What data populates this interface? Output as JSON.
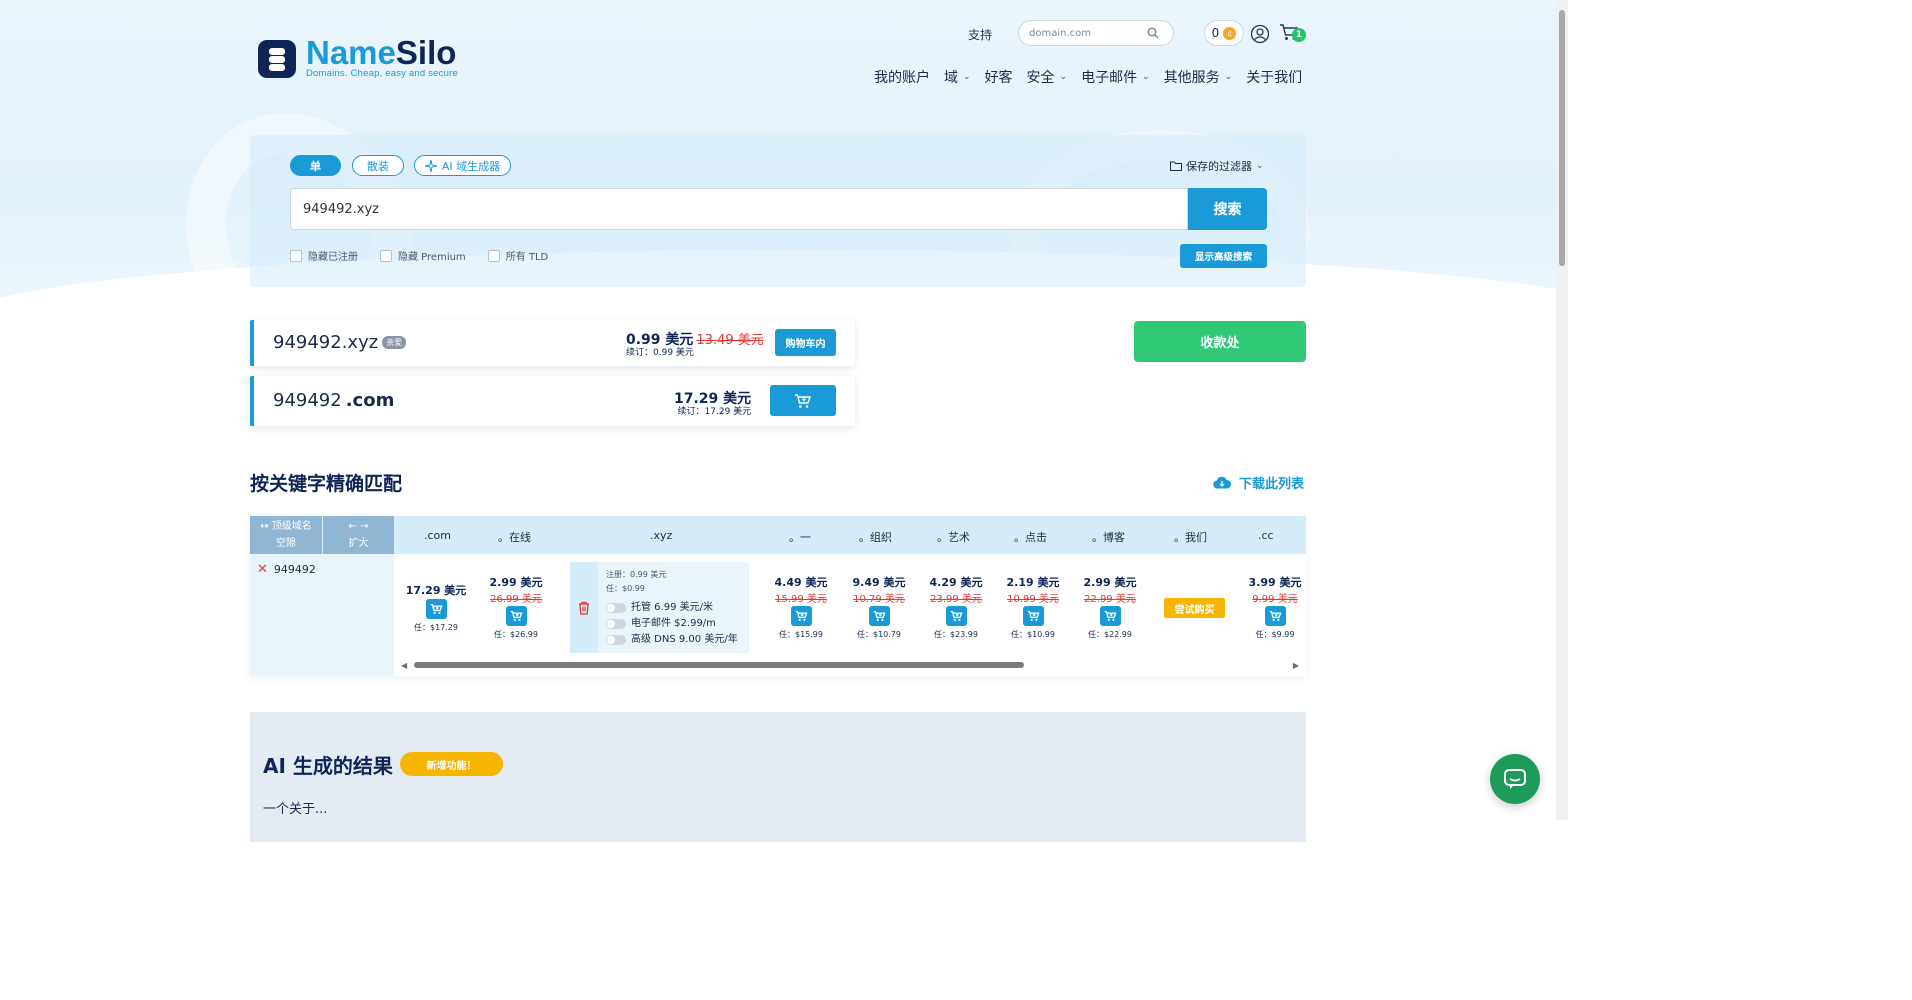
{
  "brand": {
    "name_part1": "Name",
    "name_part2": "Silo",
    "tagline": "Domains. Cheap, easy and secure"
  },
  "header": {
    "support": "支持",
    "search_placeholder": "domain.com",
    "coin_count": "0",
    "coin_symbol": "¢",
    "cart_count": "1",
    "nav": [
      {
        "label": "我的账户",
        "has_dropdown": false
      },
      {
        "label": "域",
        "has_dropdown": true
      },
      {
        "label": "好客",
        "has_dropdown": false
      },
      {
        "label": "安全",
        "has_dropdown": true
      },
      {
        "label": "电子邮件",
        "has_dropdown": true
      },
      {
        "label": "其他服务",
        "has_dropdown": true
      },
      {
        "label": "关于我们",
        "has_dropdown": false
      }
    ]
  },
  "search": {
    "modes": {
      "single": "单",
      "bulk": "散装",
      "ai": "AI 域生成器"
    },
    "saved_filters": "保存的过滤器",
    "query": "949492.xyz",
    "button": "搜索",
    "filters": {
      "hide_registered": "隐藏已注册",
      "hide_premium": "隐藏 Premium",
      "all_tld": "所有 TLD"
    },
    "advanced": "显示高级搜索"
  },
  "results": [
    {
      "name": "949492.xyz",
      "sld": "949492",
      "tld": ".xyz",
      "badge": "亲爱",
      "price": "0.99 美元",
      "old_price": "13.49 美元",
      "renew": "续订：0.99 美元",
      "action": "购物车内"
    },
    {
      "name": "949492.com",
      "sld": "949492",
      "tld": ".com",
      "price": "17.29 美元",
      "renew": "续订：17.29 美元"
    }
  ],
  "checkout": "收款处",
  "exact_match": {
    "title": "按关键字精确匹配",
    "download": "下载此列表",
    "left_header": {
      "col1_line1": "↔ 顶级域名",
      "col1_line2": "空隙",
      "col2_line1": "← →",
      "col2_line2": "扩大"
    },
    "keyword": "949492",
    "columns": [
      {
        "tld": ".com",
        "price": "17.29 美元",
        "renew": "任：$17.29"
      },
      {
        "tld": "。在线",
        "price": "2.99 美元",
        "old": "26.99 美元",
        "renew": "任：$26.99"
      },
      {
        "tld": ".xyz"
      },
      {
        "tld": "。一",
        "price": "4.49 美元",
        "old": "15.99 美元",
        "renew": "任：$15.99"
      },
      {
        "tld": "。组织",
        "price": "9.49 美元",
        "old": "10.79 美元",
        "renew": "任：$10.79"
      },
      {
        "tld": "。艺术",
        "price": "4.29 美元",
        "old": "23.99 美元",
        "renew": "任：$23.99"
      },
      {
        "tld": "。点击",
        "price": "2.19 美元",
        "old": "10.99 美元",
        "renew": "任：$10.99"
      },
      {
        "tld": "。博客",
        "price": "2.99 美元",
        "old": "22.99 美元",
        "renew": "任：$22.99"
      },
      {
        "tld": "。我们",
        "action": "尝试购买"
      },
      {
        "tld": ".cc",
        "price": "3.99 美元",
        "old": "9.99 美元",
        "renew": "任：$9.99"
      }
    ],
    "xyz_detail": {
      "registration": "注册：0.99 美元",
      "renewal": "任：$0.99",
      "hosting": "托管 6.99 美元/米",
      "email": "电子邮件 $2.99/m",
      "dns": "高级 DNS 9.00 美元/年"
    }
  },
  "ai_section": {
    "title": "AI 生成的结果",
    "badge": "新增功能！",
    "about": "一个关于..."
  },
  "colors": {
    "primary": "#1a9ad7",
    "navy": "#0f2557",
    "success": "#2fc877",
    "sale_red": "#e53935",
    "warning": "#f7b500"
  }
}
